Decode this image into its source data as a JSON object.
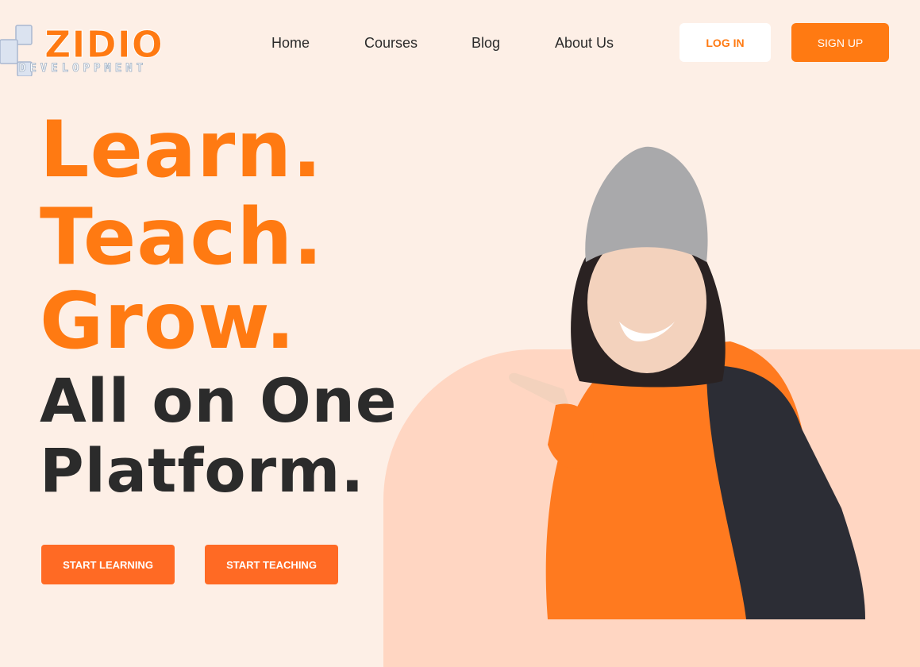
{
  "brand": {
    "name": "ZIDIO",
    "subtitle": "DEVELOPPMENT"
  },
  "nav": {
    "items": [
      "Home",
      "Courses",
      "Blog",
      "About Us"
    ]
  },
  "auth": {
    "login_label": "LOG IN",
    "signup_label": "SIGN UP"
  },
  "hero": {
    "lines": [
      "Learn.",
      "Teach.",
      "Grow.",
      "All on One",
      "Platform."
    ],
    "cta_primary": "START LEARNING",
    "cta_secondary": "START TEACHING"
  },
  "colors": {
    "accent": "#ff7a12",
    "background": "#fdefe6",
    "blob": "#ffd6c2",
    "text": "#2b2b2b"
  },
  "icons": [
    "logo-cube-icon"
  ]
}
